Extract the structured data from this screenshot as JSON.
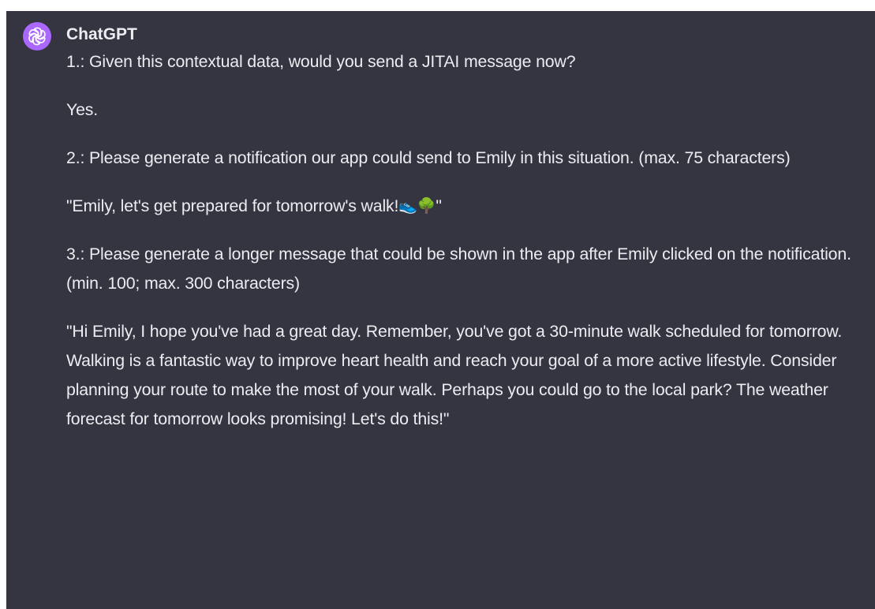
{
  "message": {
    "sender": "ChatGPT",
    "avatar_icon": "openai-logo-icon",
    "avatar_color": "#ab68ff",
    "background_color": "#343541",
    "paragraphs": {
      "q1": "1.: Given this contextual data, would you send a JITAI message now?",
      "a1": "Yes.",
      "q2": "2.: Please generate a notification our app could send to Emily in this situation. (max. 75 characters)",
      "a2_prefix": "\"Emily, let's get prepared for tomorrow's walk!",
      "a2_emoji_1": "👟",
      "a2_emoji_2": "🌳",
      "a2_suffix": "\"",
      "q3": "3.: Please generate a longer message that could be shown in the app after Emily clicked on the notification. (min. 100; max. 300 characters)",
      "a3": "\"Hi Emily, I hope you've had a great day. Remember, you've got a 30-minute walk scheduled for tomorrow. Walking is a fantastic way to improve heart health and reach your goal of a more active lifestyle. Consider planning your route to make the most of your walk. Perhaps you could go to the local park? The weather forecast for tomorrow looks promising! Let's do this!\""
    }
  }
}
